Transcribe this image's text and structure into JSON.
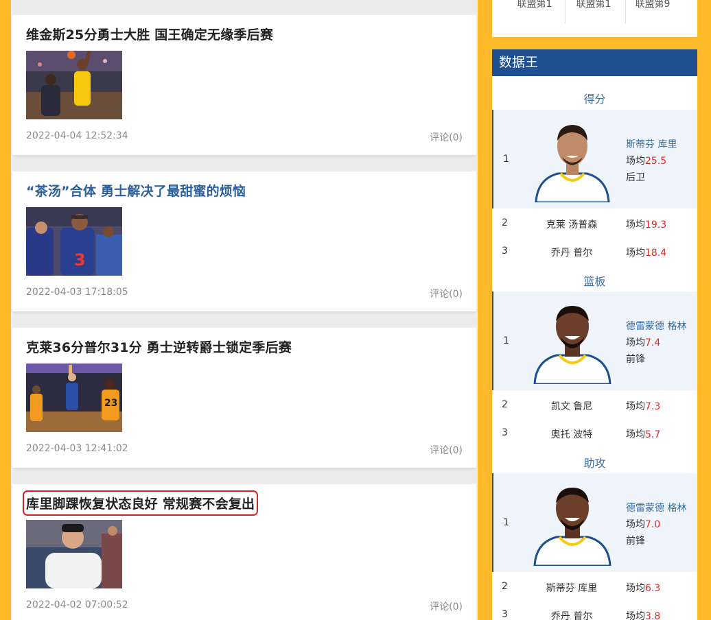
{
  "news": [
    {
      "title": "维金斯25分勇士大胜 国王确定无缘季后赛",
      "date": "2022-04-04 12:52:34",
      "comments": "评论(0)",
      "style": "normal"
    },
    {
      "title": "“茶汤”合体 勇士解决了最甜蜜的烦恼",
      "date": "2022-04-03 17:18:05",
      "comments": "评论(0)",
      "style": "link"
    },
    {
      "title": "克莱36分普尔31分 勇士逆转爵士锁定季后赛",
      "date": "2022-04-03 12:41:02",
      "comments": "评论(0)",
      "style": "normal"
    },
    {
      "title": "库里脚踝恢复状态良好 常规赛不会复出",
      "date": "2022-04-02 07:00:52",
      "comments": "评论(0)",
      "style": "boxed"
    }
  ],
  "top_box": {
    "ranks": [
      "联盟第1",
      "联盟第1",
      "联盟第9"
    ]
  },
  "stats": {
    "header": "数据王",
    "avg_label": "场均",
    "categories": [
      {
        "title": "得分",
        "leader": {
          "rank": "1",
          "name": "斯蒂芬 库里",
          "value": "25.5",
          "position": "后卫"
        },
        "others": [
          {
            "rank": "2",
            "name": "克莱 汤普森",
            "value": "19.3"
          },
          {
            "rank": "3",
            "name": "乔丹 普尔",
            "value": "18.4"
          }
        ]
      },
      {
        "title": "篮板",
        "leader": {
          "rank": "1",
          "name": "德雷蒙德 格林",
          "value": "7.4",
          "position": "前锋"
        },
        "others": [
          {
            "rank": "2",
            "name": "凯文 鲁尼",
            "value": "7.3"
          },
          {
            "rank": "3",
            "name": "奥托 波特",
            "value": "5.7"
          }
        ]
      },
      {
        "title": "助攻",
        "leader": {
          "rank": "1",
          "name": "德雷蒙德 格林",
          "value": "7.0",
          "position": "前锋"
        },
        "others": [
          {
            "rank": "2",
            "name": "斯蒂芬 库里",
            "value": "6.3"
          },
          {
            "rank": "3",
            "name": "乔丹 普尔",
            "value": "3.8"
          }
        ]
      }
    ]
  },
  "colors": {
    "page_bg": "#fdb927",
    "header_blue": "#1d4f91",
    "link_blue": "#2b5f9e",
    "stat_red": "#e02a2a",
    "highlight_box": "#e02020"
  }
}
